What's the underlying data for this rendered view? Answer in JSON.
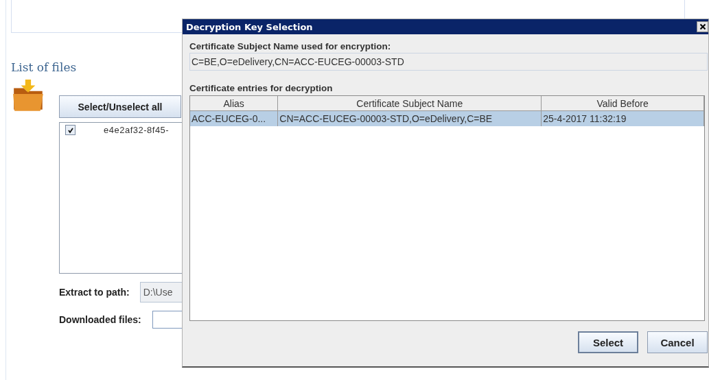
{
  "page": {
    "heading": "List of files",
    "select_all_button": "Select/Unselect all",
    "files": [
      {
        "name": "e4e2af32-8f45-",
        "checked": true
      }
    ],
    "extract_label": "Extract to path:",
    "extract_value": "D:\\Use",
    "downloaded_label": "Downloaded files:"
  },
  "dialog": {
    "title": "Decryption Key Selection",
    "subject_label": "Certificate Subject Name used for encryption:",
    "subject_value": "C=BE,O=eDelivery,CN=ACC-EUCEG-00003-STD",
    "table_label": "Certificate entries for decryption",
    "table": {
      "columns": [
        "Alias",
        "Certificate Subject Name",
        "Valid Before"
      ],
      "rows": [
        {
          "cells": [
            "ACC-EUCEG-0...",
            "CN=ACC-EUCEG-00003-STD,O=eDelivery,C=BE",
            "25-4-2017 11:32:19"
          ],
          "selected": true
        }
      ]
    },
    "buttons": [
      {
        "label": "Select",
        "default": true
      },
      {
        "label": "Cancel",
        "default": false
      }
    ]
  }
}
